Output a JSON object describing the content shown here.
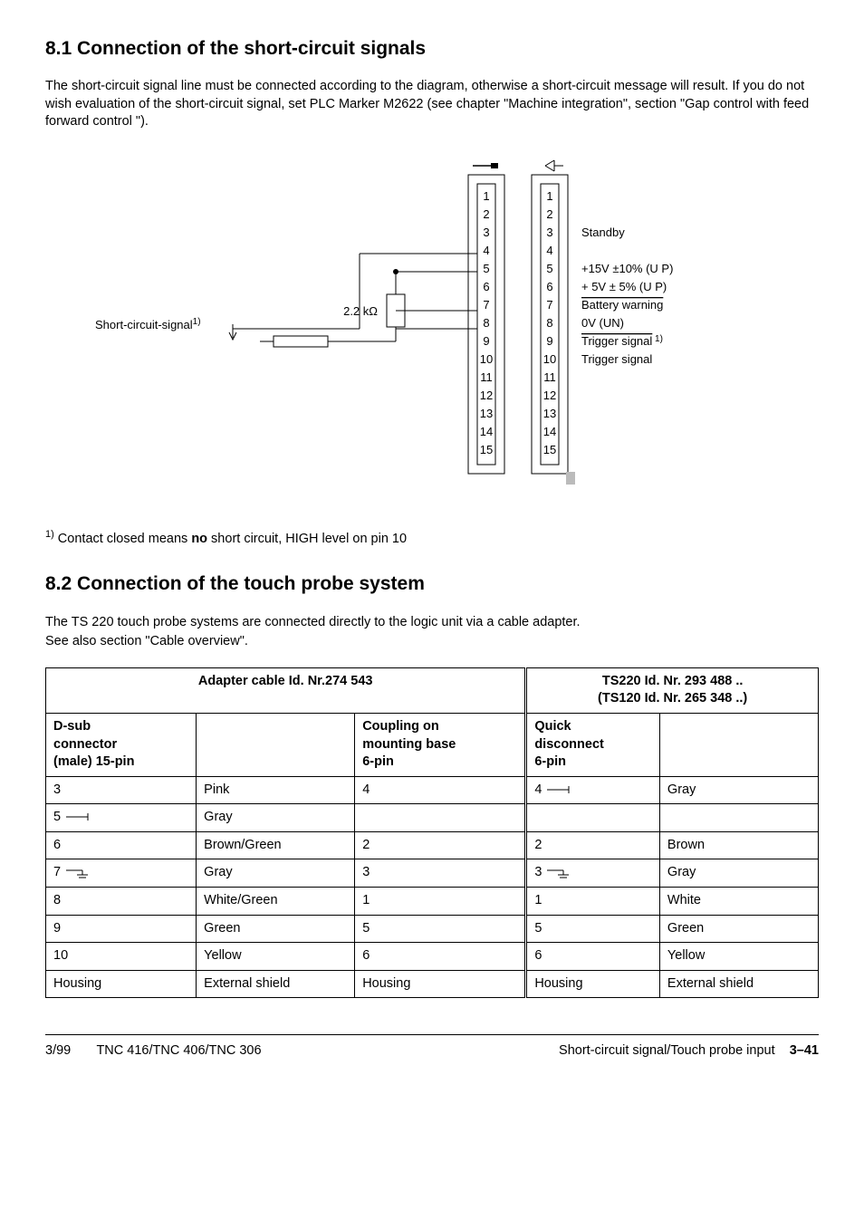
{
  "section_8_1": {
    "heading": "8.1  Connection of the short-circuit signals",
    "para": "The short-circuit signal line must be connected according to the diagram, otherwise a short-circuit message will result. If you do not wish evaluation of the short-circuit signal, set PLC Marker M2622 (see chapter \"Machine integration\", section \"Gap control with feed forward control \").",
    "diagram": {
      "left_label": "Short-circuit-signal",
      "left_label_sup": "1)",
      "resistor_label": "2.2 kΩ",
      "pins_left": [
        "1",
        "2",
        "3",
        "4",
        "5",
        "6",
        "7",
        "8",
        "9",
        "10",
        "11",
        "12",
        "13",
        "14",
        "15"
      ],
      "pins_right": [
        "1",
        "2",
        "3",
        "4",
        "5",
        "6",
        "7",
        "8",
        "9",
        "10",
        "11",
        "12",
        "13",
        "14",
        "15"
      ],
      "right_labels": {
        "3": "Standby",
        "5": "+15V ±10% (U P)",
        "6": "+  5V ±  5% (U P)",
        "7_over": "Battery warning",
        "8": "0V (UN)",
        "9_over": "Trigger signal",
        "9_sup": "1)",
        "10": "Trigger signal"
      }
    },
    "footnote_sup": "1)",
    "footnote_pre": " Contact closed means ",
    "footnote_bold": "no",
    "footnote_post": " short circuit, HIGH level on pin 10"
  },
  "section_8_2": {
    "heading": "8.2  Connection of the touch probe system",
    "para1": "The TS 220 touch probe systems are connected directly to the logic unit via a cable adapter.",
    "para2": "See also section \"Cable overview\".",
    "table": {
      "head_left": "Adapter cable  Id. Nr.274 543",
      "head_right_l1": "TS220   Id. Nr. 293 488 ..",
      "head_right_l2": "(TS120  Id. Nr. 265 348 ..)",
      "sub_left1": "D-sub connector (male) 15-pin",
      "sub_left2": "",
      "sub_left3": "Coupling on mounting base 6-pin",
      "sub_right1": "Quick disconnect 6-pin",
      "sub_right2": "",
      "rows": [
        {
          "c1": "3",
          "c2": "Pink",
          "c3": "4",
          "c4": "4",
          "c4sym": "bar",
          "c5": "Gray"
        },
        {
          "c1": "5",
          "c1sym": "bar",
          "c2": "Gray",
          "c3": "",
          "c4": "",
          "c5": ""
        },
        {
          "c1": "6",
          "c2": "Brown/Green",
          "c3": "2",
          "c4": "2",
          "c5": "Brown"
        },
        {
          "c1": "7",
          "c1sym": "gnd",
          "c2": "Gray",
          "c3": "3",
          "c4": "3",
          "c4sym": "gnd",
          "c5": "Gray"
        },
        {
          "c1": "8",
          "c2": "White/Green",
          "c3": "1",
          "c4": "1",
          "c5": "White"
        },
        {
          "c1": "9",
          "c2": "Green",
          "c3": "5",
          "c4": "5",
          "c5": "Green"
        },
        {
          "c1": "10",
          "c2": "Yellow",
          "c3": "6",
          "c4": "6",
          "c5": "Yellow"
        },
        {
          "c1": "Housing",
          "c2": "External shield",
          "c3": "Housing",
          "c4": "Housing",
          "c5": "External shield"
        }
      ]
    }
  },
  "footer": {
    "left1": "3/99",
    "left2": "TNC 416/TNC 406/TNC 306",
    "right_text": "Short-circuit signal/Touch probe input",
    "right_page": "3–41"
  }
}
